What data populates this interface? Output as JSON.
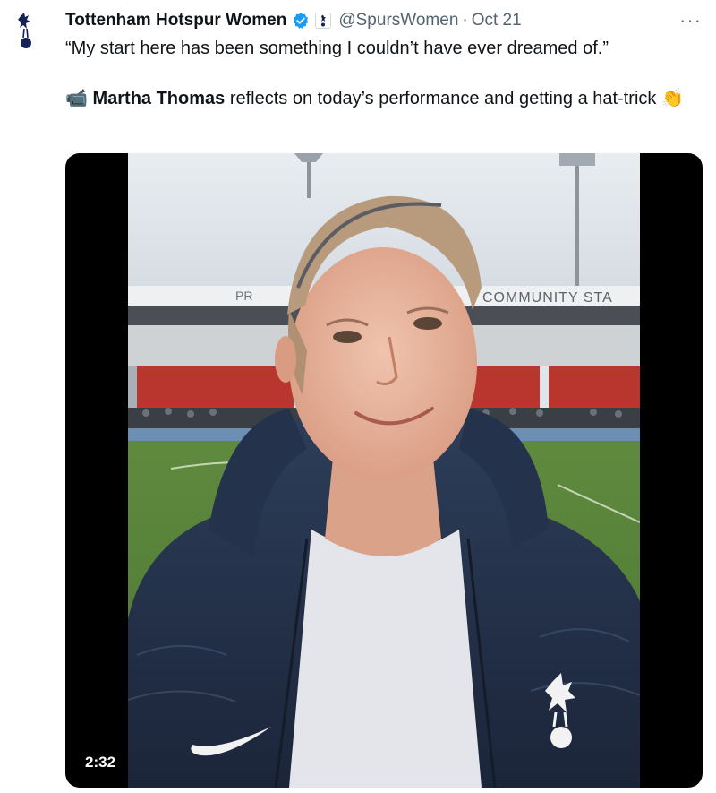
{
  "tweet": {
    "author_name": "Tottenham Hotspur Women",
    "handle": "@SpursWomen",
    "separator": "·",
    "date": "Oct 21",
    "more_label": "···",
    "text_line1": "“My start here has been something I couldn’t have ever dreamed of.”",
    "text_line2_emoji": "📹",
    "text_line2_name": "Martha Thomas",
    "text_line2_rest": " reflects on today’s performance and getting a hat-trick ",
    "text_line2_end_emoji": "👏"
  },
  "media": {
    "duration": "2:32",
    "stadium_sign": "COMMUNITY STA"
  },
  "colors": {
    "verified": "#1d9bf0",
    "text_primary": "#0f1419",
    "text_secondary": "#536471",
    "spurs_navy": "#132257"
  },
  "icons": [
    "cockerel-logo-icon",
    "verified-badge-icon",
    "affiliate-badge-icon",
    "more-icon",
    "video-camera-emoji",
    "clapping-hands-emoji"
  ]
}
